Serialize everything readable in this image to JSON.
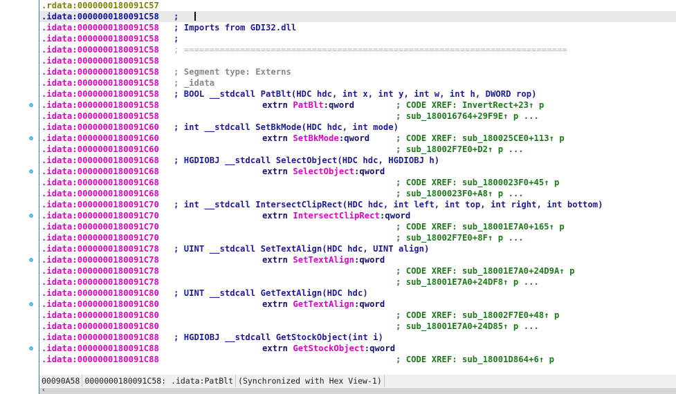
{
  "lines": [
    {
      "addr": ".rdata:0000000180091C57",
      "kind": "rdata",
      "text": ""
    },
    {
      "addr": ".idata:0000000180091C58",
      "kind": "current",
      "text": "; "
    },
    {
      "addr": ".idata:0000000180091C58",
      "kind": "comment",
      "text": "; Imports from GDI32.dll"
    },
    {
      "addr": ".idata:0000000180091C58",
      "kind": "comment",
      "text": ";"
    },
    {
      "addr": ".idata:0000000180091C58",
      "kind": "separator",
      "text": "; ==========================================================================="
    },
    {
      "addr": ".idata:0000000180091C58",
      "kind": "empty",
      "text": ""
    },
    {
      "addr": ".idata:0000000180091C58",
      "kind": "gray",
      "text": "; Segment type: Externs"
    },
    {
      "addr": ".idata:0000000180091C58",
      "kind": "gray",
      "text": "; _idata"
    },
    {
      "addr": ".idata:0000000180091C58",
      "kind": "proto",
      "text": "; BOOL __stdcall PatBlt(HDC hdc, int x, int y, int w, int h, DWORD rop)"
    },
    {
      "addr": ".idata:0000000180091C58",
      "kind": "extrn",
      "name": "PatBlt",
      "suffix": ":qword",
      "xref": "; CODE XREF: InvertRect+23",
      "xref_tail": " p",
      "dot": true
    },
    {
      "addr": ".idata:0000000180091C58",
      "kind": "xref",
      "xref": "; sub_180016764+29F9E",
      "xref_tail": " p ..."
    },
    {
      "addr": ".idata:0000000180091C60",
      "kind": "proto",
      "text": "; int __stdcall SetBkMode(HDC hdc, int mode)"
    },
    {
      "addr": ".idata:0000000180091C60",
      "kind": "extrn",
      "name": "SetBkMode",
      "suffix": ":qword",
      "xref": "; CODE XREF: sub_180025CE0+113",
      "xref_tail": " p",
      "dot": true
    },
    {
      "addr": ".idata:0000000180091C60",
      "kind": "xref",
      "xref": "; sub_18002F7E0+D2",
      "xref_tail": " p ..."
    },
    {
      "addr": ".idata:0000000180091C68",
      "kind": "proto",
      "text": "; HGDIOBJ __stdcall SelectObject(HDC hdc, HGDIOBJ h)"
    },
    {
      "addr": ".idata:0000000180091C68",
      "kind": "extrn",
      "name": "SelectObject",
      "suffix": ":qword",
      "xref": "",
      "xref_tail": "",
      "dot": true
    },
    {
      "addr": ".idata:0000000180091C68",
      "kind": "xref",
      "xref": "; CODE XREF: sub_1800023F0+45",
      "xref_tail": " p"
    },
    {
      "addr": ".idata:0000000180091C68",
      "kind": "xref",
      "xref": "; sub_1800023F0+A8",
      "xref_tail": " p ..."
    },
    {
      "addr": ".idata:0000000180091C70",
      "kind": "proto",
      "text": "; int __stdcall IntersectClipRect(HDC hdc, int left, int top, int right, int bottom)"
    },
    {
      "addr": ".idata:0000000180091C70",
      "kind": "extrn",
      "name": "IntersectClipRect",
      "suffix": ":qword",
      "xref": "",
      "xref_tail": "",
      "dot": true
    },
    {
      "addr": ".idata:0000000180091C70",
      "kind": "xref",
      "xref": "; CODE XREF: sub_18001E7A0+165",
      "xref_tail": " p"
    },
    {
      "addr": ".idata:0000000180091C70",
      "kind": "xref",
      "xref": "; sub_18002F7E0+8F",
      "xref_tail": " p ..."
    },
    {
      "addr": ".idata:0000000180091C78",
      "kind": "proto",
      "text": "; UINT __stdcall SetTextAlign(HDC hdc, UINT align)"
    },
    {
      "addr": ".idata:0000000180091C78",
      "kind": "extrn",
      "name": "SetTextAlign",
      "suffix": ":qword",
      "xref": "",
      "xref_tail": "",
      "dot": true
    },
    {
      "addr": ".idata:0000000180091C78",
      "kind": "xref",
      "xref": "; CODE XREF: sub_18001E7A0+24D9A",
      "xref_tail": " p"
    },
    {
      "addr": ".idata:0000000180091C78",
      "kind": "xref",
      "xref": "; sub_18001E7A0+24DF8",
      "xref_tail": " p ..."
    },
    {
      "addr": ".idata:0000000180091C80",
      "kind": "proto",
      "text": "; UINT __stdcall GetTextAlign(HDC hdc)"
    },
    {
      "addr": ".idata:0000000180091C80",
      "kind": "extrn",
      "name": "GetTextAlign",
      "suffix": ":qword",
      "xref": "",
      "xref_tail": "",
      "dot": true
    },
    {
      "addr": ".idata:0000000180091C80",
      "kind": "xref",
      "xref": "; CODE XREF: sub_18002F7E0+48",
      "xref_tail": " p"
    },
    {
      "addr": ".idata:0000000180091C80",
      "kind": "xref",
      "xref": "; sub_18001E7A0+24D85",
      "xref_tail": " p ..."
    },
    {
      "addr": ".idata:0000000180091C88",
      "kind": "proto",
      "text": "; HGDIOBJ __stdcall GetStockObject(int i)"
    },
    {
      "addr": ".idata:0000000180091C88",
      "kind": "extrn",
      "name": "GetStockObject",
      "suffix": ":qword",
      "xref": "",
      "xref_tail": "",
      "dot": true
    },
    {
      "addr": ".idata:0000000180091C88",
      "kind": "xref",
      "xref": "; CODE XREF: sub_18001D864+6",
      "xref_tail": " p"
    }
  ],
  "extrn_keyword": "extrn",
  "xref_arrow": "↑",
  "status": {
    "offset": "00090A58",
    "location": "0000000180091C58: .idata:PatBlt",
    "sync": "(Synchronized with Hex View-1)"
  },
  "scrollbar": {
    "left_arrow": "‹"
  }
}
